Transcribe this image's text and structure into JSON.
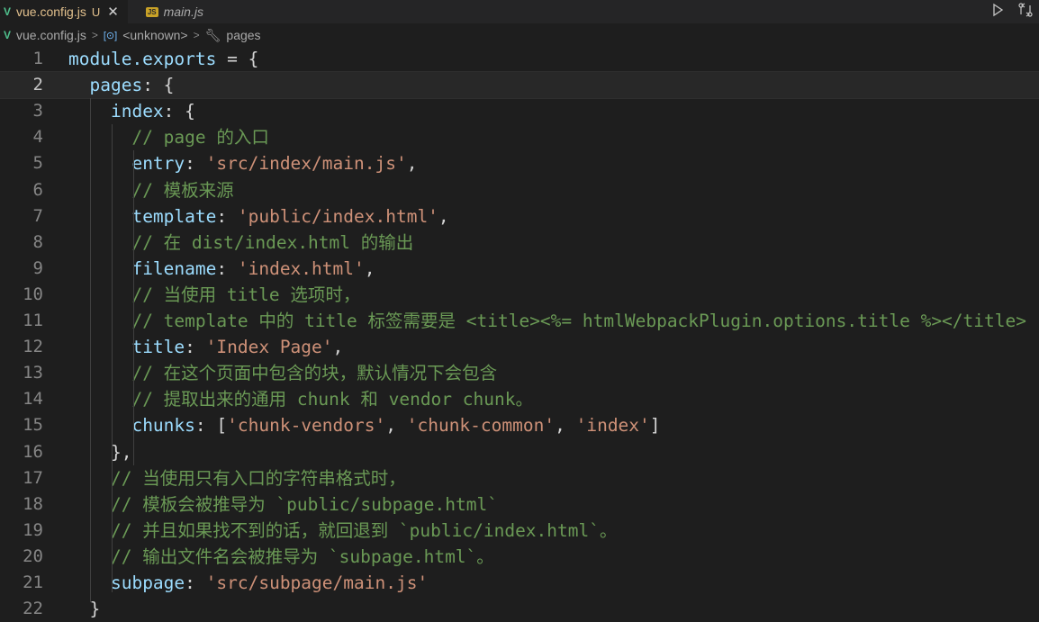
{
  "tabs": [
    {
      "label": "vue.config.js",
      "status": "U",
      "active": true
    },
    {
      "label": "main.js",
      "active": false
    }
  ],
  "breadcrumb": [
    "vue.config.js",
    "<unknown>",
    "pages"
  ],
  "editor": {
    "current_line": 2,
    "lines": [
      {
        "n": "1",
        "tokens": [
          {
            "t": "k",
            "v": "module.exports"
          },
          {
            "t": "p",
            "v": " = {"
          }
        ]
      },
      {
        "n": "2",
        "tokens": [
          {
            "t": "p",
            "v": "  "
          },
          {
            "t": "k",
            "v": "pages"
          },
          {
            "t": "p",
            "v": ": {"
          }
        ]
      },
      {
        "n": "3",
        "tokens": [
          {
            "t": "p",
            "v": "    "
          },
          {
            "t": "k",
            "v": "index"
          },
          {
            "t": "p",
            "v": ": {"
          }
        ]
      },
      {
        "n": "4",
        "tokens": [
          {
            "t": "p",
            "v": "      "
          },
          {
            "t": "c",
            "v": "// page 的入口"
          }
        ]
      },
      {
        "n": "5",
        "tokens": [
          {
            "t": "p",
            "v": "      "
          },
          {
            "t": "k",
            "v": "entry"
          },
          {
            "t": "p",
            "v": ": "
          },
          {
            "t": "s",
            "v": "'src/index/main.js'"
          },
          {
            "t": "p",
            "v": ","
          }
        ]
      },
      {
        "n": "6",
        "tokens": [
          {
            "t": "p",
            "v": "      "
          },
          {
            "t": "c",
            "v": "// 模板来源"
          }
        ]
      },
      {
        "n": "7",
        "tokens": [
          {
            "t": "p",
            "v": "      "
          },
          {
            "t": "k",
            "v": "template"
          },
          {
            "t": "p",
            "v": ": "
          },
          {
            "t": "s",
            "v": "'public/index.html'"
          },
          {
            "t": "p",
            "v": ","
          }
        ]
      },
      {
        "n": "8",
        "tokens": [
          {
            "t": "p",
            "v": "      "
          },
          {
            "t": "c",
            "v": "// 在 dist/index.html 的输出"
          }
        ]
      },
      {
        "n": "9",
        "tokens": [
          {
            "t": "p",
            "v": "      "
          },
          {
            "t": "k",
            "v": "filename"
          },
          {
            "t": "p",
            "v": ": "
          },
          {
            "t": "s",
            "v": "'index.html'"
          },
          {
            "t": "p",
            "v": ","
          }
        ]
      },
      {
        "n": "10",
        "tokens": [
          {
            "t": "p",
            "v": "      "
          },
          {
            "t": "c",
            "v": "// 当使用 title 选项时，"
          }
        ]
      },
      {
        "n": "11",
        "tokens": [
          {
            "t": "p",
            "v": "      "
          },
          {
            "t": "c",
            "v": "// template 中的 title 标签需要是 <title><%= htmlWebpackPlugin.options.title %></title>"
          }
        ]
      },
      {
        "n": "12",
        "tokens": [
          {
            "t": "p",
            "v": "      "
          },
          {
            "t": "k",
            "v": "title"
          },
          {
            "t": "p",
            "v": ": "
          },
          {
            "t": "s",
            "v": "'Index Page'"
          },
          {
            "t": "p",
            "v": ","
          }
        ]
      },
      {
        "n": "13",
        "tokens": [
          {
            "t": "p",
            "v": "      "
          },
          {
            "t": "c",
            "v": "// 在这个页面中包含的块，默认情况下会包含"
          }
        ]
      },
      {
        "n": "14",
        "tokens": [
          {
            "t": "p",
            "v": "      "
          },
          {
            "t": "c",
            "v": "// 提取出来的通用 chunk 和 vendor chunk。"
          }
        ]
      },
      {
        "n": "15",
        "tokens": [
          {
            "t": "p",
            "v": "      "
          },
          {
            "t": "k",
            "v": "chunks"
          },
          {
            "t": "p",
            "v": ": ["
          },
          {
            "t": "s",
            "v": "'chunk-vendors'"
          },
          {
            "t": "p",
            "v": ", "
          },
          {
            "t": "s",
            "v": "'chunk-common'"
          },
          {
            "t": "p",
            "v": ", "
          },
          {
            "t": "s",
            "v": "'index'"
          },
          {
            "t": "p",
            "v": "]"
          }
        ]
      },
      {
        "n": "16",
        "tokens": [
          {
            "t": "p",
            "v": "    },"
          }
        ]
      },
      {
        "n": "17",
        "tokens": [
          {
            "t": "p",
            "v": "    "
          },
          {
            "t": "c",
            "v": "// 当使用只有入口的字符串格式时，"
          }
        ]
      },
      {
        "n": "18",
        "tokens": [
          {
            "t": "p",
            "v": "    "
          },
          {
            "t": "c",
            "v": "// 模板会被推导为 `public/subpage.html`"
          }
        ]
      },
      {
        "n": "19",
        "tokens": [
          {
            "t": "p",
            "v": "    "
          },
          {
            "t": "c",
            "v": "// 并且如果找不到的话，就回退到 `public/index.html`。"
          }
        ]
      },
      {
        "n": "20",
        "tokens": [
          {
            "t": "p",
            "v": "    "
          },
          {
            "t": "c",
            "v": "// 输出文件名会被推导为 `subpage.html`。"
          }
        ]
      },
      {
        "n": "21",
        "tokens": [
          {
            "t": "p",
            "v": "    "
          },
          {
            "t": "k",
            "v": "subpage"
          },
          {
            "t": "p",
            "v": ": "
          },
          {
            "t": "s",
            "v": "'src/subpage/main.js'"
          }
        ]
      },
      {
        "n": "22",
        "tokens": [
          {
            "t": "p",
            "v": "  }"
          }
        ]
      }
    ]
  },
  "colors": {
    "background": "#1e1e1e",
    "property": "#9cdcfe",
    "string": "#ce9178",
    "comment": "#6a9955",
    "punctuation": "#d4d4d4"
  },
  "icons": {
    "vue_file": "vue-file-icon",
    "js_file": "js-file-icon",
    "close": "close-icon",
    "run": "play-icon",
    "compare": "compare-changes-icon",
    "symbol_object": "symbol-object-icon",
    "symbol_property": "wrench-icon"
  }
}
